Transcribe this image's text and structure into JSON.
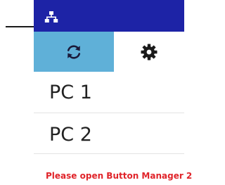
{
  "titlebar": {
    "icon": "network-icon",
    "color": "#1d23a6"
  },
  "tabs": [
    {
      "icon": "refresh-icon",
      "active": true,
      "color": "#5fb0d8"
    },
    {
      "icon": "gear-icon",
      "active": false
    }
  ],
  "pc_list": {
    "items": [
      {
        "label": "PC 1"
      },
      {
        "label": "PC 2"
      }
    ]
  },
  "status": {
    "message": "Please open Button Manager 2",
    "color": "#e0242a"
  }
}
